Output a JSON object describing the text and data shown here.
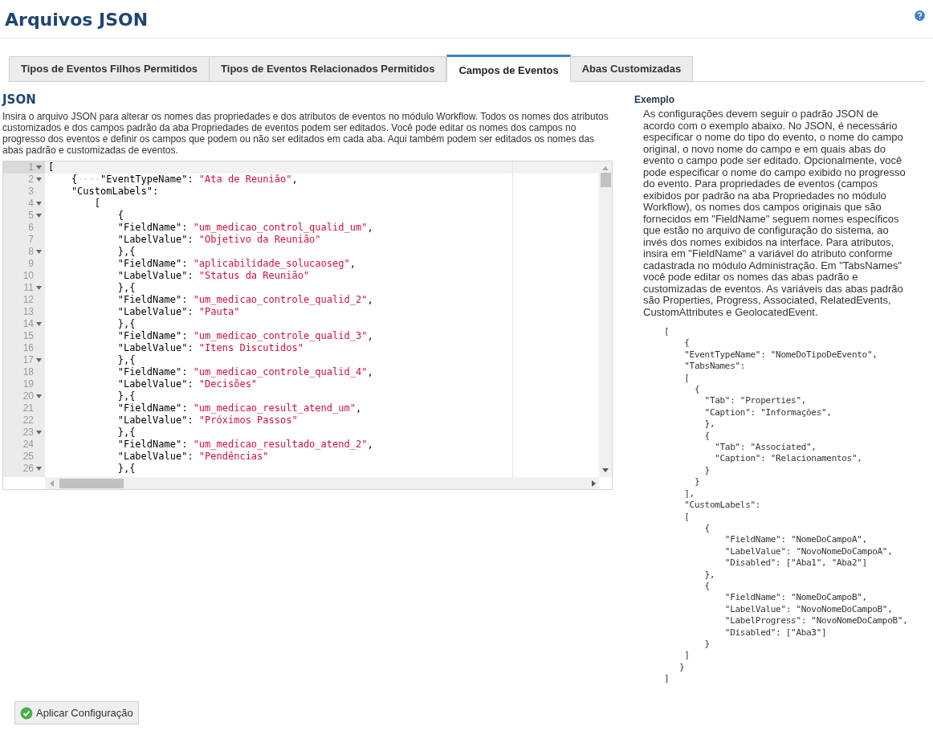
{
  "page": {
    "title": "Arquivos JSON"
  },
  "tabs": [
    {
      "label": "Tipos de Eventos Filhos Permitidos",
      "selected": false
    },
    {
      "label": "Tipos de Eventos Relacionados Permitidos",
      "selected": false
    },
    {
      "label": "Campos de Eventos",
      "selected": true
    },
    {
      "label": "Abas Customizadas",
      "selected": false
    }
  ],
  "json_section": {
    "heading": "JSON",
    "description": "Insira o arquivo JSON para alterar os nomes das propriedades e dos atributos de eventos no módulo Workflow. Todos os nomes dos atributos customizados e dos campos padrão da aba Propriedades de eventos podem ser editados. Você pode editar os nomes dos campos no progresso dos eventos e definir os campos que podem ou não ser editados em cada aba. Aqui também podem ser editados os nomes das abas padrão e customizadas de eventos.",
    "editor": {
      "lines": [
        {
          "number": "1",
          "foldable": true,
          "active": true,
          "segments": [
            {
              "kind": "punct",
              "text": "["
            }
          ]
        },
        {
          "number": "2",
          "foldable": true,
          "active": false,
          "segments": [
            {
              "kind": "punct",
              "text": "    {"
            },
            {
              "kind": "whitespace",
              "text": "····"
            },
            {
              "kind": "key",
              "text": "\"EventTypeName\": "
            },
            {
              "kind": "string",
              "text": "\"Ata de Reunião\""
            },
            {
              "kind": "punct",
              "text": ","
            }
          ]
        },
        {
          "number": "3",
          "foldable": false,
          "active": false,
          "segments": [
            {
              "kind": "key",
              "text": "    \"CustomLabels\":"
            }
          ]
        },
        {
          "number": "4",
          "foldable": true,
          "active": false,
          "segments": [
            {
              "kind": "punct",
              "text": "        ["
            }
          ]
        },
        {
          "number": "5",
          "foldable": true,
          "active": false,
          "segments": [
            {
              "kind": "punct",
              "text": "            {"
            }
          ]
        },
        {
          "number": "6",
          "foldable": false,
          "active": false,
          "segments": [
            {
              "kind": "key",
              "text": "            \"FieldName\": "
            },
            {
              "kind": "string",
              "text": "\"um_medicao_control_qualid_um\""
            },
            {
              "kind": "punct",
              "text": ","
            }
          ]
        },
        {
          "number": "7",
          "foldable": false,
          "active": false,
          "segments": [
            {
              "kind": "key",
              "text": "            \"LabelValue\": "
            },
            {
              "kind": "string",
              "text": "\"Objetivo da Reunião\""
            }
          ]
        },
        {
          "number": "8",
          "foldable": true,
          "active": false,
          "segments": [
            {
              "kind": "punct",
              "text": "            },{"
            }
          ]
        },
        {
          "number": "9",
          "foldable": false,
          "active": false,
          "segments": [
            {
              "kind": "key",
              "text": "            \"FieldName\": "
            },
            {
              "kind": "string",
              "text": "\"aplicabilidade_solucaoseg\""
            },
            {
              "kind": "punct",
              "text": ","
            }
          ]
        },
        {
          "number": "10",
          "foldable": false,
          "active": false,
          "segments": [
            {
              "kind": "key",
              "text": "            \"LabelValue\": "
            },
            {
              "kind": "string",
              "text": "\"Status da Reunião\""
            }
          ]
        },
        {
          "number": "11",
          "foldable": true,
          "active": false,
          "segments": [
            {
              "kind": "punct",
              "text": "            },{"
            }
          ]
        },
        {
          "number": "12",
          "foldable": false,
          "active": false,
          "segments": [
            {
              "kind": "key",
              "text": "            \"FieldName\": "
            },
            {
              "kind": "string",
              "text": "\"um_medicao_controle_qualid_2\""
            },
            {
              "kind": "punct",
              "text": ","
            }
          ]
        },
        {
          "number": "13",
          "foldable": false,
          "active": false,
          "segments": [
            {
              "kind": "key",
              "text": "            \"LabelValue\": "
            },
            {
              "kind": "string",
              "text": "\"Pauta\""
            }
          ]
        },
        {
          "number": "14",
          "foldable": true,
          "active": false,
          "segments": [
            {
              "kind": "punct",
              "text": "            },{"
            }
          ]
        },
        {
          "number": "15",
          "foldable": false,
          "active": false,
          "segments": [
            {
              "kind": "key",
              "text": "            \"FieldName\": "
            },
            {
              "kind": "string",
              "text": "\"um_medicao_controle_qualid_3\""
            },
            {
              "kind": "punct",
              "text": ","
            }
          ]
        },
        {
          "number": "16",
          "foldable": false,
          "active": false,
          "segments": [
            {
              "kind": "key",
              "text": "            \"LabelValue\": "
            },
            {
              "kind": "string",
              "text": "\"Itens Discutidos\""
            }
          ]
        },
        {
          "number": "17",
          "foldable": true,
          "active": false,
          "segments": [
            {
              "kind": "punct",
              "text": "            },{"
            }
          ]
        },
        {
          "number": "18",
          "foldable": false,
          "active": false,
          "segments": [
            {
              "kind": "key",
              "text": "            \"FieldName\": "
            },
            {
              "kind": "string",
              "text": "\"um_medicao_controle_qualid_4\""
            },
            {
              "kind": "punct",
              "text": ","
            }
          ]
        },
        {
          "number": "19",
          "foldable": false,
          "active": false,
          "segments": [
            {
              "kind": "key",
              "text": "            \"LabelValue\": "
            },
            {
              "kind": "string",
              "text": "\"Decisões\""
            }
          ]
        },
        {
          "number": "20",
          "foldable": true,
          "active": false,
          "segments": [
            {
              "kind": "punct",
              "text": "            },{"
            }
          ]
        },
        {
          "number": "21",
          "foldable": false,
          "active": false,
          "segments": [
            {
              "kind": "key",
              "text": "            \"FieldName\": "
            },
            {
              "kind": "string",
              "text": "\"um_medicao_result_atend_um\""
            },
            {
              "kind": "punct",
              "text": ","
            }
          ]
        },
        {
          "number": "22",
          "foldable": false,
          "active": false,
          "segments": [
            {
              "kind": "key",
              "text": "            \"LabelValue\": "
            },
            {
              "kind": "string",
              "text": "\"Próximos Passos\""
            }
          ]
        },
        {
          "number": "23",
          "foldable": true,
          "active": false,
          "segments": [
            {
              "kind": "punct",
              "text": "            },{"
            }
          ]
        },
        {
          "number": "24",
          "foldable": false,
          "active": false,
          "segments": [
            {
              "kind": "key",
              "text": "            \"FieldName\": "
            },
            {
              "kind": "string",
              "text": "\"um_medicao_resultado_atend_2\""
            },
            {
              "kind": "punct",
              "text": ","
            }
          ]
        },
        {
          "number": "25",
          "foldable": false,
          "active": false,
          "segments": [
            {
              "kind": "key",
              "text": "            \"LabelValue\": "
            },
            {
              "kind": "string",
              "text": "\"Pendências\""
            }
          ]
        },
        {
          "number": "26",
          "foldable": true,
          "active": false,
          "segments": [
            {
              "kind": "punct",
              "text": "            },{"
            }
          ]
        }
      ]
    }
  },
  "example_section": {
    "heading": "Exemplo",
    "description": "As configurações devem seguir o padrão JSON de acordo com o exemplo abaixo. No JSON, é necessário especificar o nome do tipo do evento, o nome do campo original, o novo nome do campo e em quais abas do evento o campo pode ser editado. Opcionalmente, você pode especificar o nome do campo exibido no progresso do evento. Para propriedades de eventos (campos exibidos por padrão na aba Propriedades no módulo Workflow), os nomes dos campos originais que são fornecidos em \"FieldName\" seguem nomes específicos que estão no arquivo de configuração do sistema, ao invés dos nomes exibidos na interface. Para atributos, insira em \"FieldName\" a variável do atributo conforme cadastrada no módulo Administração. Em \"TabsNames\" você pode editar os nomes das abas padrão e customizadas de eventos. As variáveis das abas padrão são Properties, Progress, Associated, RelatedEvents, CustomAttributes e GeolocatedEvent.",
    "code": "[\n    {\n    \"EventTypeName\": \"NomeDoTipoDeEvento\",\n    \"TabsNames\":\n    [\n      {\n        \"Tab\": \"Properties\",\n        \"Caption\": \"Informações\",\n        },\n        {\n          \"Tab\": \"Associated\",\n          \"Caption\": \"Relacionamentos\",\n        }\n      }\n    ],\n    \"CustomLabels\":\n    [\n        {\n            \"FieldName\": \"NomeDoCampoA\",\n            \"LabelValue\": \"NovoNomeDoCampoA\",\n            \"Disabled\": [\"Aba1\", \"Aba2\"]\n        },\n        {\n            \"FieldName\": \"NomeDoCampoB\",\n            \"LabelValue\": \"NovoNomeDoCampoB\",\n            \"LabelProgress\": \"NovoNomeDoCampoB\",\n            \"Disabled\": [\"Aba3\"]\n        }\n    ]\n   }\n]"
  },
  "apply_button": {
    "label": "Aplicar Configuração"
  }
}
